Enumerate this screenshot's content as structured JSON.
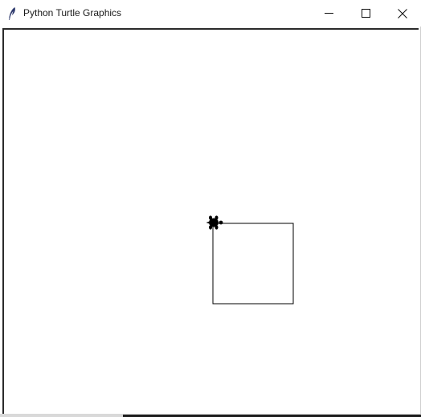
{
  "window": {
    "title": "Python Turtle Graphics",
    "icon": "feather-icon"
  },
  "controls": {
    "minimize_icon": "minimize-icon",
    "maximize_icon": "maximize-icon",
    "close_icon": "close-icon"
  },
  "canvas": {
    "background": "#ffffff",
    "pen_color": "#000000",
    "shapes": [
      {
        "type": "square",
        "side": 100
      }
    ],
    "turtle": {
      "shape": "turtle",
      "heading_deg": 0,
      "color": "#000000"
    }
  }
}
